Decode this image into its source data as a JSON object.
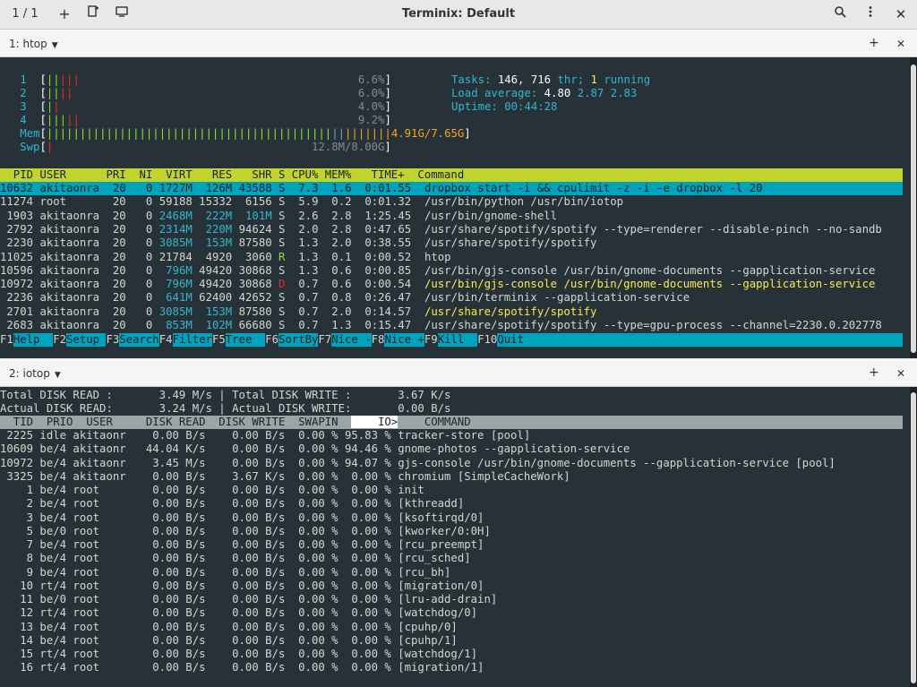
{
  "titlebar": {
    "session_counter": "1 / 1",
    "title": "Terminix: Default"
  },
  "panes": [
    {
      "label": "1: htop"
    },
    {
      "label": "2: iotop"
    }
  ],
  "htop": {
    "cpus": [
      {
        "id": "1",
        "pct": "6.6%"
      },
      {
        "id": "2",
        "pct": "6.0%"
      },
      {
        "id": "3",
        "pct": "4.0%"
      },
      {
        "id": "4",
        "pct": "9.2%"
      }
    ],
    "mem": {
      "label": "Mem",
      "value": "4.91G/7.65G"
    },
    "swp": {
      "label": "Swp",
      "value": "12.8M/8.00G"
    },
    "tasks": {
      "label": "Tasks:",
      "count": "146,",
      "thr": "716",
      "thr_label": "thr;",
      "running": "1",
      "running_label": "running"
    },
    "load": {
      "label": "Load average:",
      "v1": "4.80",
      "v2": "2.87",
      "v3": "2.83"
    },
    "uptime": {
      "label": "Uptime:",
      "value": "00:44:28"
    },
    "header": "  PID USER      PRI  NI  VIRT   RES   SHR S CPU% MEM%   TIME+  Command",
    "processes": [
      {
        "pid": "10632",
        "user": "akitaonra",
        "pri": "20",
        "ni": "0",
        "virt": "1727M",
        "res": "126M",
        "shr": "43588",
        "s": "S",
        "cpu": "7.3",
        "mem": "1.6",
        "time": "0:01.55",
        "cmd": "dropbox start -i && cpulimit -z -i -e dropbox -l 20"
      },
      {
        "pid": "11274",
        "user": "root",
        "pri": "20",
        "ni": "0",
        "virt": "59188",
        "res": "15332",
        "shr": "6156",
        "s": "S",
        "cpu": "5.9",
        "mem": "0.2",
        "time": "0:01.32",
        "cmd": "/usr/bin/python /usr/bin/iotop"
      },
      {
        "pid": "1903",
        "user": "akitaonra",
        "pri": "20",
        "ni": "0",
        "virt": "2468M",
        "res": "222M",
        "shr": "101M",
        "s": "S",
        "cpu": "2.6",
        "mem": "2.8",
        "time": "1:25.45",
        "cmd": "/usr/bin/gnome-shell"
      },
      {
        "pid": "2792",
        "user": "akitaonra",
        "pri": "20",
        "ni": "0",
        "virt": "2314M",
        "res": "220M",
        "shr": "94624",
        "s": "S",
        "cpu": "2.0",
        "mem": "2.8",
        "time": "0:47.65",
        "cmd": "/usr/share/spotify/spotify --type=renderer --disable-pinch --no-sandb"
      },
      {
        "pid": "2230",
        "user": "akitaonra",
        "pri": "20",
        "ni": "0",
        "virt": "3085M",
        "res": "153M",
        "shr": "87580",
        "s": "S",
        "cpu": "1.3",
        "mem": "2.0",
        "time": "0:38.55",
        "cmd": "/usr/share/spotify/spotify"
      },
      {
        "pid": "11025",
        "user": "akitaonra",
        "pri": "20",
        "ni": "0",
        "virt": "21784",
        "res": "4920",
        "shr": "3060",
        "s": "R",
        "cpu": "1.3",
        "mem": "0.1",
        "time": "0:00.52",
        "cmd": "htop"
      },
      {
        "pid": "10596",
        "user": "akitaonra",
        "pri": "20",
        "ni": "0",
        "virt": "796M",
        "res": "49420",
        "shr": "30868",
        "s": "S",
        "cpu": "1.3",
        "mem": "0.6",
        "time": "0:00.85",
        "cmd": "/usr/bin/gjs-console /usr/bin/gnome-documents --gapplication-service"
      },
      {
        "pid": "10972",
        "user": "akitaonra",
        "pri": "20",
        "ni": "0",
        "virt": "796M",
        "res": "49420",
        "shr": "30868",
        "s": "D",
        "cpu": "0.7",
        "mem": "0.6",
        "time": "0:00.54",
        "cmd": "/usr/bin/gjs-console /usr/bin/gnome-documents --gapplication-service"
      },
      {
        "pid": "2236",
        "user": "akitaonra",
        "pri": "20",
        "ni": "0",
        "virt": "641M",
        "res": "62400",
        "shr": "42652",
        "s": "S",
        "cpu": "0.7",
        "mem": "0.8",
        "time": "0:26.47",
        "cmd": "/usr/bin/terminix --gapplication-service"
      },
      {
        "pid": "2701",
        "user": "akitaonra",
        "pri": "20",
        "ni": "0",
        "virt": "3085M",
        "res": "153M",
        "shr": "87580",
        "s": "S",
        "cpu": "0.7",
        "mem": "2.0",
        "time": "0:14.57",
        "cmd": "/usr/share/spotify/spotify"
      },
      {
        "pid": "2683",
        "user": "akitaonra",
        "pri": "20",
        "ni": "0",
        "virt": "853M",
        "res": "102M",
        "shr": "66680",
        "s": "S",
        "cpu": "0.7",
        "mem": "1.3",
        "time": "0:15.47",
        "cmd": "/usr/share/spotify/spotify --type=gpu-process --channel=2230.0.202778"
      }
    ],
    "fkeys": [
      {
        "k": "F1",
        "l": "Help  "
      },
      {
        "k": "F2",
        "l": "Setup "
      },
      {
        "k": "F3",
        "l": "Search"
      },
      {
        "k": "F4",
        "l": "Filter"
      },
      {
        "k": "F5",
        "l": "Tree  "
      },
      {
        "k": "F6",
        "l": "SortBy"
      },
      {
        "k": "F7",
        "l": "Nice -"
      },
      {
        "k": "F8",
        "l": "Nice +"
      },
      {
        "k": "F9",
        "l": "Kill  "
      },
      {
        "k": "F10",
        "l": "Quit"
      }
    ]
  },
  "iotop": {
    "line1": "Total DISK READ :       3.49 M/s | Total DISK WRITE :       3.67 K/s",
    "line2": "Actual DISK READ:       3.24 M/s | Actual DISK WRITE:       0.00 B/s",
    "header_pre": "  TID  PRIO  USER     DISK READ  DISK WRITE  SWAPIN  ",
    "header_io": "    IO>",
    "header_post": "    COMMAND",
    "rows": [
      "  2225 idle akitaonr    0.00 B/s    0.00 B/s  0.00 % 95.83 % tracker-store [pool]",
      "10609 be/4 akitaonr   44.04 K/s    0.00 B/s  0.00 % 94.46 % gnome-photos --gapplication-service",
      "10972 be/4 akitaonr    3.45 M/s    0.00 B/s  0.00 % 94.07 % gjs-console /usr/bin/gnome-documents --gapplication-service [pool]",
      " 3325 be/4 akitaonr    0.00 B/s    3.67 K/s  0.00 %  0.00 % chromium [SimpleCacheWork]",
      "    1 be/4 root        0.00 B/s    0.00 B/s  0.00 %  0.00 % init",
      "    2 be/4 root        0.00 B/s    0.00 B/s  0.00 %  0.00 % [kthreadd]",
      "    3 be/4 root        0.00 B/s    0.00 B/s  0.00 %  0.00 % [ksoftirqd/0]",
      "    5 be/0 root        0.00 B/s    0.00 B/s  0.00 %  0.00 % [kworker/0:0H]",
      "    7 be/4 root        0.00 B/s    0.00 B/s  0.00 %  0.00 % [rcu_preempt]",
      "    8 be/4 root        0.00 B/s    0.00 B/s  0.00 %  0.00 % [rcu_sched]",
      "    9 be/4 root        0.00 B/s    0.00 B/s  0.00 %  0.00 % [rcu_bh]",
      "   10 rt/4 root        0.00 B/s    0.00 B/s  0.00 %  0.00 % [migration/0]",
      "   11 be/0 root        0.00 B/s    0.00 B/s  0.00 %  0.00 % [lru-add-drain]",
      "   12 rt/4 root        0.00 B/s    0.00 B/s  0.00 %  0.00 % [watchdog/0]",
      "   13 be/4 root        0.00 B/s    0.00 B/s  0.00 %  0.00 % [cpuhp/0]",
      "   14 be/4 root        0.00 B/s    0.00 B/s  0.00 %  0.00 % [cpuhp/1]",
      "   15 rt/4 root        0.00 B/s    0.00 B/s  0.00 %  0.00 % [watchdog/1]",
      "   16 rt/4 root        0.00 B/s    0.00 B/s  0.00 %  0.00 % [migration/1]"
    ]
  },
  "colors": {
    "accent": "#00a3bd",
    "header_bar": "#c0d42c",
    "terminal_bg": "#263238"
  }
}
